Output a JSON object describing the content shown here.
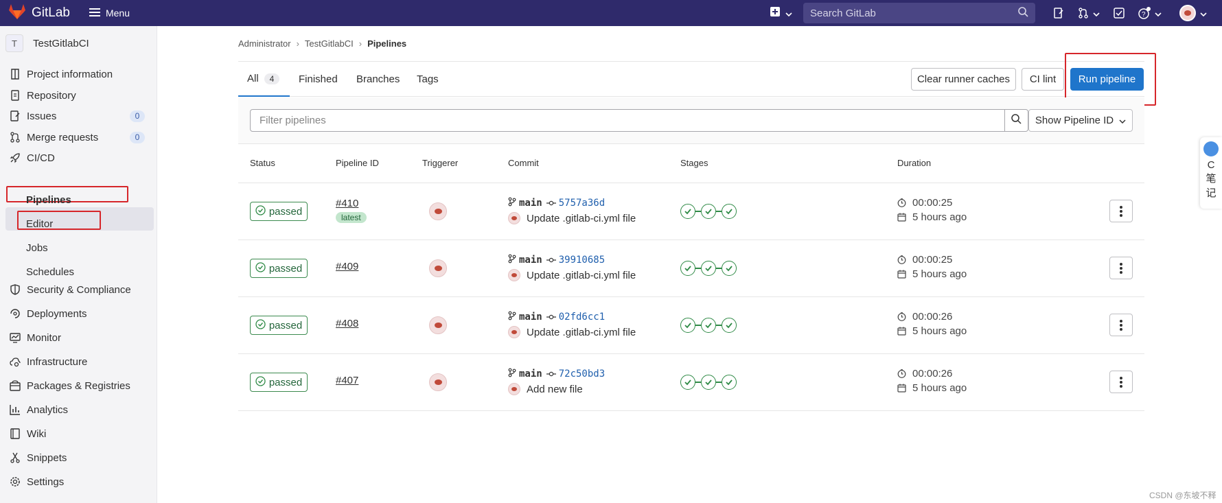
{
  "topbar": {
    "brand": "GitLab",
    "menu_label": "Menu",
    "search_placeholder": "Search GitLab"
  },
  "sidebar": {
    "project_initial": "T",
    "project_name": "TestGitlabCI",
    "items": [
      {
        "label": "Project information",
        "icon": "info-doc-icon"
      },
      {
        "label": "Repository",
        "icon": "doc-icon"
      },
      {
        "label": "Issues",
        "icon": "issues-icon",
        "badge": "0"
      },
      {
        "label": "Merge requests",
        "icon": "merge-request-icon",
        "badge": "0"
      },
      {
        "label": "CI/CD",
        "icon": "rocket-icon"
      },
      {
        "label": "Security & Compliance",
        "icon": "shield-icon"
      },
      {
        "label": "Deployments",
        "icon": "deployments-icon"
      },
      {
        "label": "Monitor",
        "icon": "monitor-icon"
      },
      {
        "label": "Infrastructure",
        "icon": "cloud-gear-icon"
      },
      {
        "label": "Packages & Registries",
        "icon": "package-icon"
      },
      {
        "label": "Analytics",
        "icon": "chart-icon"
      },
      {
        "label": "Wiki",
        "icon": "book-icon"
      },
      {
        "label": "Snippets",
        "icon": "scissors-icon"
      },
      {
        "label": "Settings",
        "icon": "gear-icon"
      }
    ],
    "cicd_sub": [
      "Pipelines",
      "Editor",
      "Jobs",
      "Schedules"
    ]
  },
  "breadcrumb": [
    "Administrator",
    "TestGitlabCI",
    "Pipelines"
  ],
  "tabs": [
    {
      "label": "All",
      "count": "4"
    },
    {
      "label": "Finished"
    },
    {
      "label": "Branches"
    },
    {
      "label": "Tags"
    }
  ],
  "actions": {
    "clear_caches": "Clear runner caches",
    "ci_lint": "CI lint",
    "run_pipeline": "Run pipeline"
  },
  "filter": {
    "placeholder": "Filter pipelines",
    "sort_label": "Show Pipeline ID"
  },
  "table": {
    "headers": [
      "Status",
      "Pipeline ID",
      "Triggerer",
      "Commit",
      "Stages",
      "Duration"
    ],
    "rows": [
      {
        "status": "passed",
        "id": "#410",
        "tag": "latest",
        "branch": "main",
        "sha": "5757a36d",
        "message": "Update .gitlab-ci.yml file",
        "duration": "00:00:25",
        "finished": "5 hours ago"
      },
      {
        "status": "passed",
        "id": "#409",
        "branch": "main",
        "sha": "39910685",
        "message": "Update .gitlab-ci.yml file",
        "duration": "00:00:25",
        "finished": "5 hours ago"
      },
      {
        "status": "passed",
        "id": "#408",
        "branch": "main",
        "sha": "02fd6cc1",
        "message": "Update .gitlab-ci.yml file",
        "duration": "00:00:26",
        "finished": "5 hours ago"
      },
      {
        "status": "passed",
        "id": "#407",
        "branch": "main",
        "sha": "72c50bd3",
        "message": "Add new file",
        "duration": "00:00:26",
        "finished": "5 hours ago"
      }
    ]
  },
  "side_widget": [
    "C",
    "笔",
    "记"
  ],
  "watermark": "CSDN @东坡不释",
  "colors": {
    "topbar": "#2f2a6b",
    "primary": "#1f75cb",
    "success": "#2f8a46",
    "highlight": "#d6262a"
  }
}
